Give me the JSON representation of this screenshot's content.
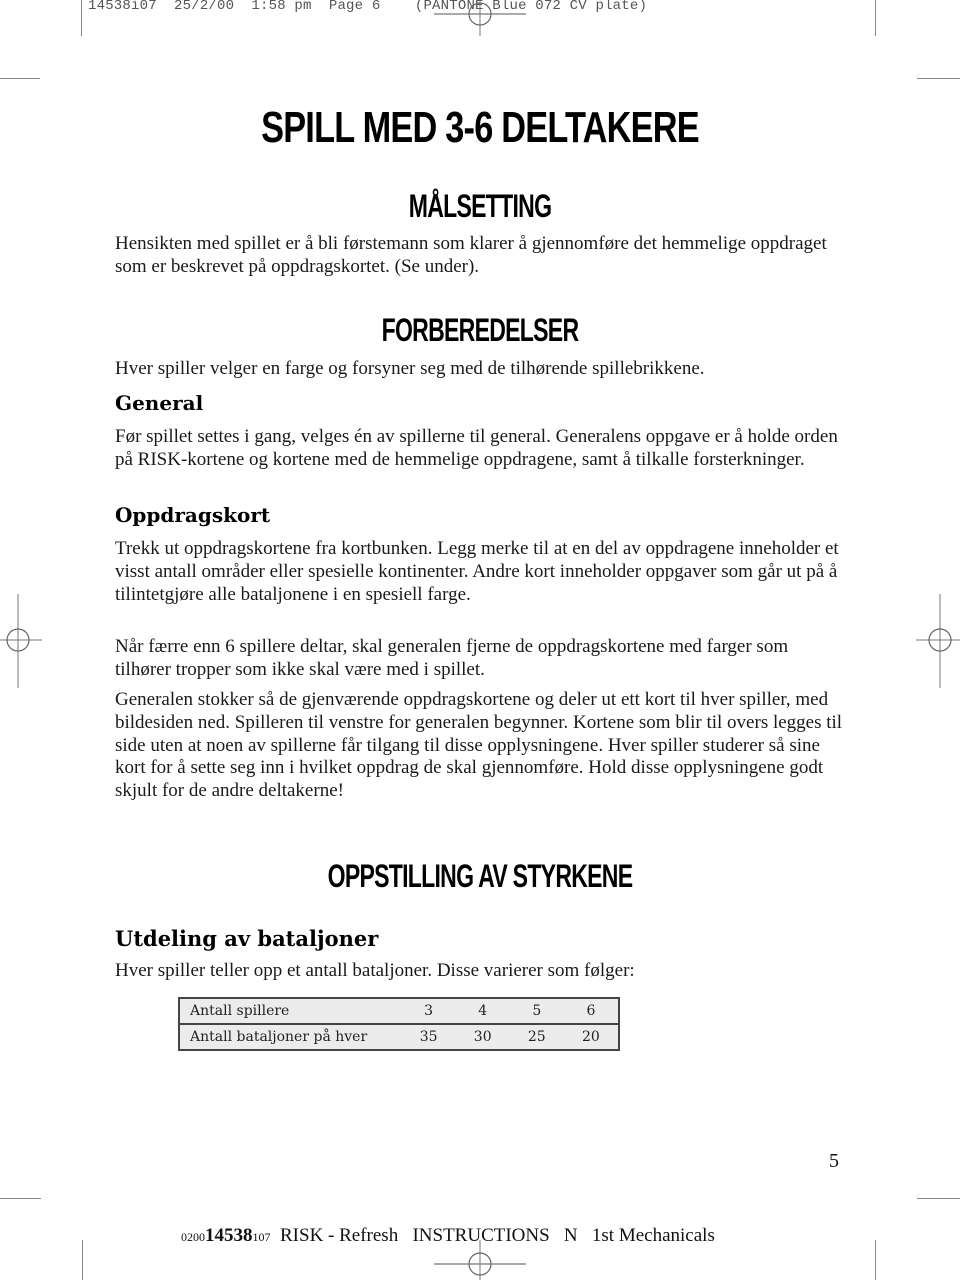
{
  "print_slug": "14538i07  25/2/00  1:58 pm  Page 6    (PANTONE Blue 072 CV plate)",
  "title": "SPILL MED 3-6 DELTAKERE",
  "sections": {
    "malsetting": {
      "heading": "MÅLSETTING",
      "text": "Hensikten med spillet er å bli førstemann som klarer å gjennomføre det hemmelige oppdraget som er beskrevet på oppdragskortet. (Se under)."
    },
    "forberedelser": {
      "heading": "FORBEREDELSER",
      "text": "Hver spiller velger en farge og forsyner seg med de tilhørende spillebrikkene.",
      "general": {
        "heading": "General",
        "text": "Før spillet settes i gang, velges én av spillerne til general. Generalens oppgave er å holde orden på RISK-kortene og kortene med de hemmelige oppdragene, samt å tilkalle forsterkninger."
      },
      "oppdragskort": {
        "heading": "Oppdragskort",
        "paragraphs": [
          "Trekk ut oppdragskortene fra kortbunken. Legg merke til at en del av oppdragene inneholder et visst antall områder eller spesielle kontinenter. Andre kort inneholder oppgaver som går ut på å tilintetgjøre alle bataljonene i en spesiell farge.",
          "Når færre enn 6 spillere deltar, skal generalen fjerne de oppdragskortene med farger som tilhører tropper som ikke skal være med i spillet.",
          "Generalen stokker så de gjenværende oppdragskortene og deler ut ett kort til hver spiller, med bildesiden ned. Spilleren til venstre for generalen begynner. Kortene som blir til overs legges til side uten at noen av spillerne får tilgang til disse opplysningene. Hver spiller studerer så sine kort for å sette seg inn i hvilket oppdrag de skal gjennomføre. Hold disse opplysningene godt skjult for de andre deltakerne!"
        ]
      }
    },
    "oppstilling": {
      "heading": "OPPSTILLING AV STYRKENE",
      "utdeling": {
        "heading": "Utdeling av bataljoner",
        "text": "Hver spiller teller opp et antall bataljoner. Disse varierer som følger:"
      },
      "table": {
        "rows": [
          {
            "label": "Antall spillere",
            "values": [
              "3",
              "4",
              "5",
              "6"
            ]
          },
          {
            "label": "Antall bataljoner på hver",
            "values": [
              "35",
              "30",
              "25",
              "20"
            ]
          }
        ]
      }
    }
  },
  "page_number": "5",
  "footer": {
    "code_prefix": "0200",
    "code_main": "14538",
    "code_suffix": "107",
    "text": "  RISK - Refresh   INSTRUCTIONS   N   1st Mechanicals"
  }
}
